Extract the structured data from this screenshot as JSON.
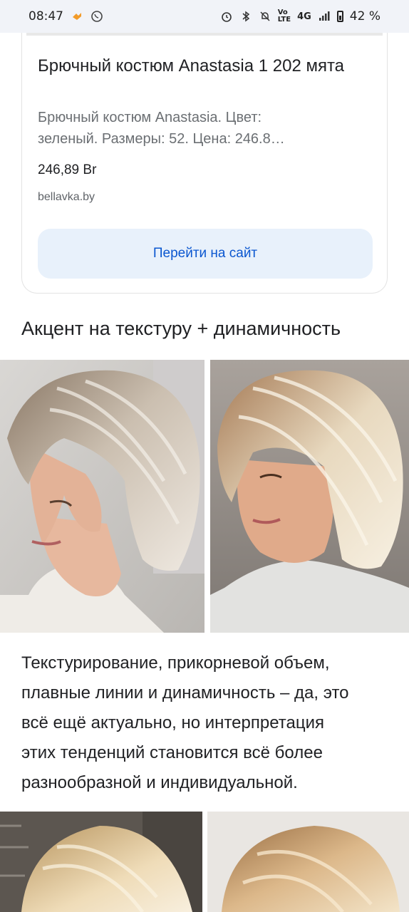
{
  "status_bar": {
    "time": "08:47",
    "battery": "42 %",
    "network": "4G",
    "volte": "Vo)\nLTE"
  },
  "card": {
    "title": "Брючный костюм Anastasia 1 202 мята",
    "description": "Брючный костюм Anastasia. Цвет:\nзеленый. Размеры: 52. Цена: 246.8…",
    "price": "246,89 Br",
    "domain": "bellavka.by",
    "button_label": "Перейти на сайт"
  },
  "section": {
    "heading": "Акцент на текстуру + динамичность",
    "paragraph": "Текстурирование, прикорневой объем,\nплавные линии и динамичность – да, это\nвсё ещё актуально, но интерпретация\nэтих тенденций становится всё более\nразнообразной и индивидуальной."
  },
  "images": [
    {
      "name": "bob-haircut-photo-left"
    },
    {
      "name": "bob-haircut-photo-right"
    },
    {
      "name": "blonde-haircut-photo-left-bottom"
    },
    {
      "name": "blonde-haircut-photo-right-bottom"
    }
  ],
  "icons": [
    "tinder-like-flame-icon",
    "viber-icon",
    "alarm-icon",
    "bluetooth-icon",
    "mute-icon",
    "signal-icon",
    "battery-icon"
  ]
}
